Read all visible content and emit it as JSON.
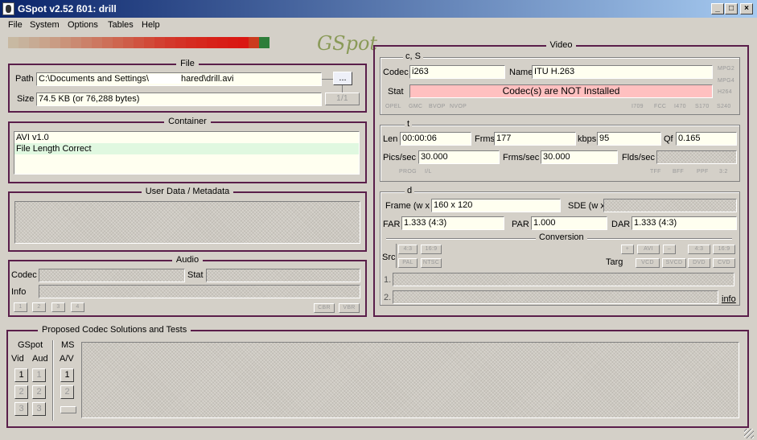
{
  "window": {
    "title": "GSpot v2.52 ß01: drill"
  },
  "menu": [
    "File",
    "System",
    "Options",
    "Tables",
    "Help"
  ],
  "logo_text": "GSpot",
  "lights": [
    "#c8b9a2",
    "#c7b29c",
    "#c7ab94",
    "#c9a48c",
    "#c99c84",
    "#ca937a",
    "#ca8a72",
    "#cb8169",
    "#cc7861",
    "#cd6f58",
    "#ce664f",
    "#ce5d48",
    "#d05340",
    "#d14a38",
    "#d24031",
    "#d3382b",
    "#d43226",
    "#d52c21",
    "#d6281d",
    "#d72219",
    "#d81e17",
    "#d91a14",
    "#da1712",
    "#cb3a1e",
    "#2e7d3a"
  ],
  "file": {
    "legend": "File",
    "path_label": "Path",
    "path_value": "C:\\Documents and Settings\\",
    "path_value_tail": "hared\\drill.avi",
    "browse": "...",
    "size_label": "Size",
    "size_value": "74.5 KB (or 76,288 bytes)",
    "counter": "1/1"
  },
  "container": {
    "legend": "Container",
    "lines": [
      "AVI v1.0",
      "File Length Correct"
    ]
  },
  "userdata": {
    "legend": "User Data / Metadata"
  },
  "audio": {
    "legend": "Audio",
    "codec_label": "Codec",
    "stat_label": "Stat",
    "info_label": "Info",
    "streams": [
      "1",
      "2",
      "3",
      "4"
    ],
    "cbr": "CBR",
    "vbr": "VBR"
  },
  "proposed": {
    "legend": "Proposed Codec Solutions and Tests",
    "gspot": "GSpot",
    "vid": "Vid",
    "aud": "Aud",
    "ms": "MS",
    "av": "A/V",
    "nums": [
      "1",
      "2",
      "3"
    ]
  },
  "video": {
    "legend": "Video",
    "cs": {
      "legend": "c, S",
      "codec_label": "Codec",
      "codec_value": "i263",
      "name_label": "Name",
      "name_value": "ITU H.263",
      "stat_label": "Stat",
      "stat_value": "Codec(s) are NOT Installed",
      "mpg": [
        "MPG2",
        "MPG4",
        "H264"
      ],
      "flags_left": [
        "OPEL",
        "GMC",
        "BVOP",
        "NVOP"
      ],
      "flags_right": [
        "I709",
        "FCC",
        "I470",
        "S170",
        "S240"
      ]
    },
    "t": {
      "legend": "t",
      "len_label": "Len",
      "len_value": "00:00:06",
      "frms_label": "Frms",
      "frms_value": "177",
      "kbps_label": "kbps",
      "kbps_value": "95",
      "qf_label": "Qf",
      "qf_value": "0.165",
      "pics_label": "Pics/sec",
      "pics_value": "30.000",
      "frmsec_label": "Frms/sec",
      "frmsec_value": "30.000",
      "flds_label": "Flds/sec",
      "flags_left": [
        "PROG",
        "I/L"
      ],
      "flags_right": [
        "TFF",
        "BFF",
        "PPF",
        "3:2"
      ]
    },
    "d": {
      "legend": "d",
      "frame_label": "Frame (w x",
      "frame_value": "160 x 120",
      "sde_label": "SDE (w x",
      "far_label": "FAR",
      "far_value": "1.333 (4:3)",
      "par_label": "PAR",
      "par_value": "1.000",
      "dar_label": "DAR",
      "dar_value": "1.333 (4:3)",
      "conversion": "Conversion",
      "src_label": "Src",
      "src_btns": [
        "4:3",
        "16:9",
        "PAL",
        "NTSC"
      ],
      "targ_label": "Targ",
      "targ_top": [
        "+",
        "AVI",
        "–",
        "4:3",
        "16:9"
      ],
      "targ_bottom": [
        "VCD",
        "SVCD",
        "DVD",
        "CVD"
      ],
      "line1": "1.",
      "line2": "2.",
      "info_link": "info"
    }
  }
}
